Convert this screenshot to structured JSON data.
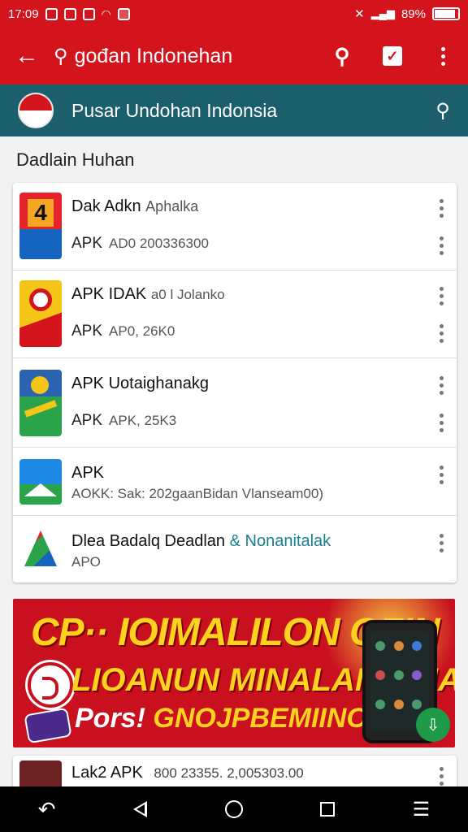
{
  "status_bar": {
    "time": "17:09",
    "battery": "89%",
    "battery_level": 0.89,
    "icons": [
      "notification-icon",
      "notification-icon",
      "notification-icon",
      "wifi-icon",
      "notification-icon",
      "dnd-icon",
      "signal-icon",
      "battery-icon"
    ]
  },
  "app_bar": {
    "search_value": "gođan Indonehan",
    "icons": [
      "back-arrow-icon",
      "search-icon",
      "check-icon",
      "more-vert-icon"
    ],
    "color": "#d3141c"
  },
  "sub_bar": {
    "title": "Pusar Undohan Indonsia",
    "color": "#1c5f6c"
  },
  "section": {
    "title": "Dadlain Huhan"
  },
  "apps": [
    {
      "title": "Dak Adkn",
      "title2": "Aphalka",
      "l2_main": "APK",
      "l2_sub": "AD0 200336300",
      "icon_colors": [
        "#e4232a",
        "#f5a623",
        "#1565c0"
      ]
    },
    {
      "title": "APK IDAK",
      "title2": "a0 l Jolanko",
      "l2_main": "APK",
      "l2_sub": "AP0, 26K0",
      "icon_colors": [
        "#f5c518",
        "#d3141c",
        "#111111"
      ]
    },
    {
      "title": "APK Uotaighanakg",
      "title2": "",
      "l2_main": "APK",
      "l2_sub": "APK, 25K3",
      "icon_colors": [
        "#2b63b0",
        "#2aa34a",
        "#e4232a"
      ]
    },
    {
      "title": "APK",
      "title2": "",
      "l2_main": "",
      "l2_sub": "AOKK: Sak: 202gaanBidan Vlanseam00)",
      "icon_colors": [
        "#1e88e5",
        "#2aa34a",
        "#ffffff"
      ]
    },
    {
      "title": "Dlea Badalq",
      "title2": "Deadlan",
      "title3": "& Nonanitalak",
      "l2_main": "",
      "l2_sub": "APO",
      "icon_colors": [
        "#e4232a",
        "#2aa34a",
        "#1565c0"
      ]
    }
  ],
  "banner": {
    "line1": "CP·· IOIMALILON OFIN",
    "line2": "LIOANUN MINALAMAINAN",
    "line3a": "Pors!",
    "line3b": "GNOJPBEMIINORS"
  },
  "last_app": {
    "title": "Lak2 APK",
    "sub": "800 23355. 2,005303.00"
  },
  "nav_bar": {
    "icons": [
      "back-gesture-icon",
      "back-icon",
      "home-icon",
      "recents-icon",
      "menu-icon"
    ]
  }
}
